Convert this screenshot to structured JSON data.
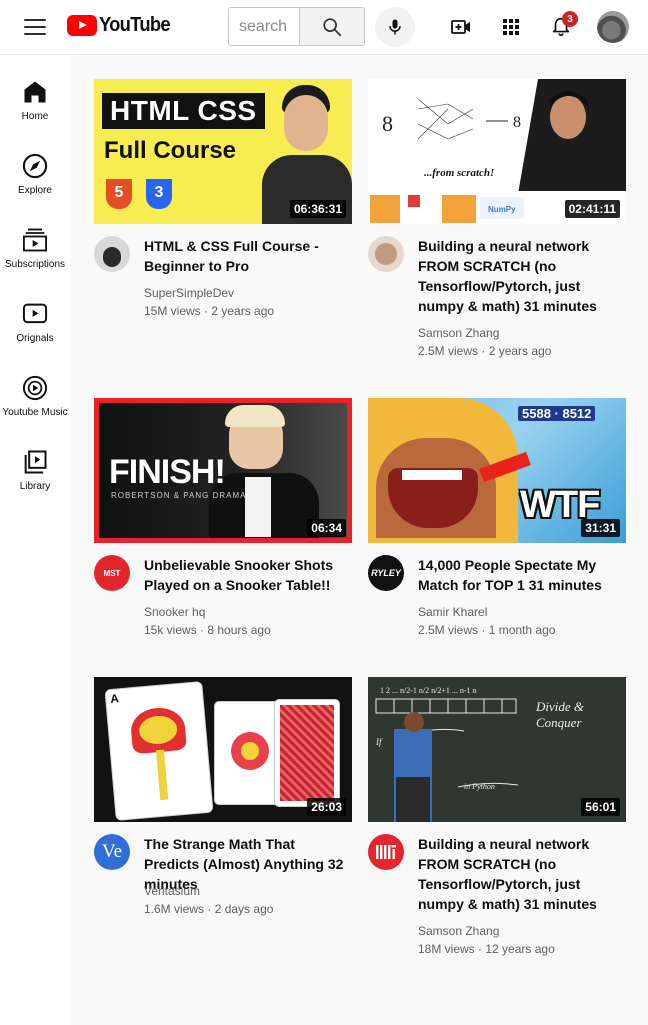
{
  "header": {
    "logo_text": "YouTube",
    "search_placeholder": "search",
    "notification_count": "3"
  },
  "sidebar": {
    "items": [
      {
        "label": "Home",
        "icon": "home-icon"
      },
      {
        "label": "Explore",
        "icon": "compass-icon"
      },
      {
        "label": "Subscriptions",
        "icon": "subscriptions-icon"
      },
      {
        "label": "Orignals",
        "icon": "originals-icon"
      },
      {
        "label": "Youtube Music",
        "icon": "music-icon"
      },
      {
        "label": "Library",
        "icon": "library-icon"
      }
    ]
  },
  "videos": [
    {
      "title": "HTML & CSS Full Course - Beginner to Pro",
      "channel": "SuperSimpleDev",
      "views": "15M views",
      "age": "2 years ago",
      "duration": "06:36:31",
      "thumb_text_1": "HTML CSS",
      "thumb_text_2": "Full Course"
    },
    {
      "title": "Building a neural network FROM SCRATCH (no Tensorflow/Pytorch, just numpy & math) 31 minutes",
      "channel": "Samson Zhang",
      "views": "2.5M views",
      "age": "2 years ago",
      "duration": "02:41:11",
      "thumb_text_1": "...from scratch!"
    },
    {
      "title": "Unbelievable Snooker Shots Played on a Snooker Table!!",
      "channel": "Snooker hq",
      "views": "15k views",
      "age": "8 hours ago",
      "duration": "06:34",
      "thumb_text_1": "FINISH!",
      "thumb_text_2": "ROBERTSON & PANG DRAMA"
    },
    {
      "title": "14,000 People Spectate My Match for TOP 1 31 minutes",
      "channel": "Samir Kharel",
      "views": "2.5M views",
      "age": "1 month ago",
      "duration": "31:31",
      "thumb_text_1": "WTF",
      "thumb_text_2": "5588 · 8512"
    },
    {
      "title": "The Strange Math That Predicts (Almost) Anything 32 minutes",
      "channel": "Veritasium",
      "views": "1.6M views",
      "age": "2 days ago",
      "duration": "26:03",
      "avatar_text": "Ve"
    },
    {
      "title": "Building a neural network FROM SCRATCH (no Tensorflow/Pytorch, just numpy & math) 31 minutes",
      "channel": "Samson Zhang",
      "views": "18M views",
      "age": "12 years ago",
      "duration": "56:01",
      "thumb_text_1": "Divide & Conquer"
    }
  ]
}
